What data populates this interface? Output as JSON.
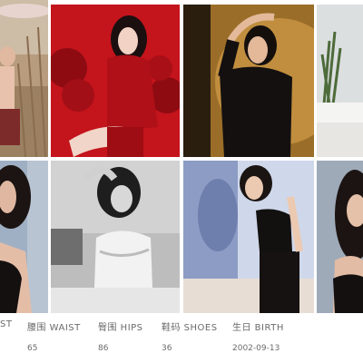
{
  "photos": [
    {
      "name": "photo-meadow-umbrella"
    },
    {
      "name": "photo-red-dress-flowers"
    },
    {
      "name": "photo-black-turtleneck"
    },
    {
      "name": "photo-bed-plant"
    },
    {
      "name": "photo-black-camisole-left"
    },
    {
      "name": "photo-white-lace-bw"
    },
    {
      "name": "photo-black-outfit-shadow"
    },
    {
      "name": "photo-black-top-right"
    }
  ],
  "stats": {
    "bust_label_fragment": "ST",
    "waist_label": "腰围 WAIST",
    "waist_value": "65",
    "hips_label": "臀围 HIPS",
    "hips_value": "86",
    "shoes_label": "鞋码 SHOES",
    "shoes_value": "36",
    "birth_label": "生日 BIRTH",
    "birth_value": "2002-09-13"
  }
}
